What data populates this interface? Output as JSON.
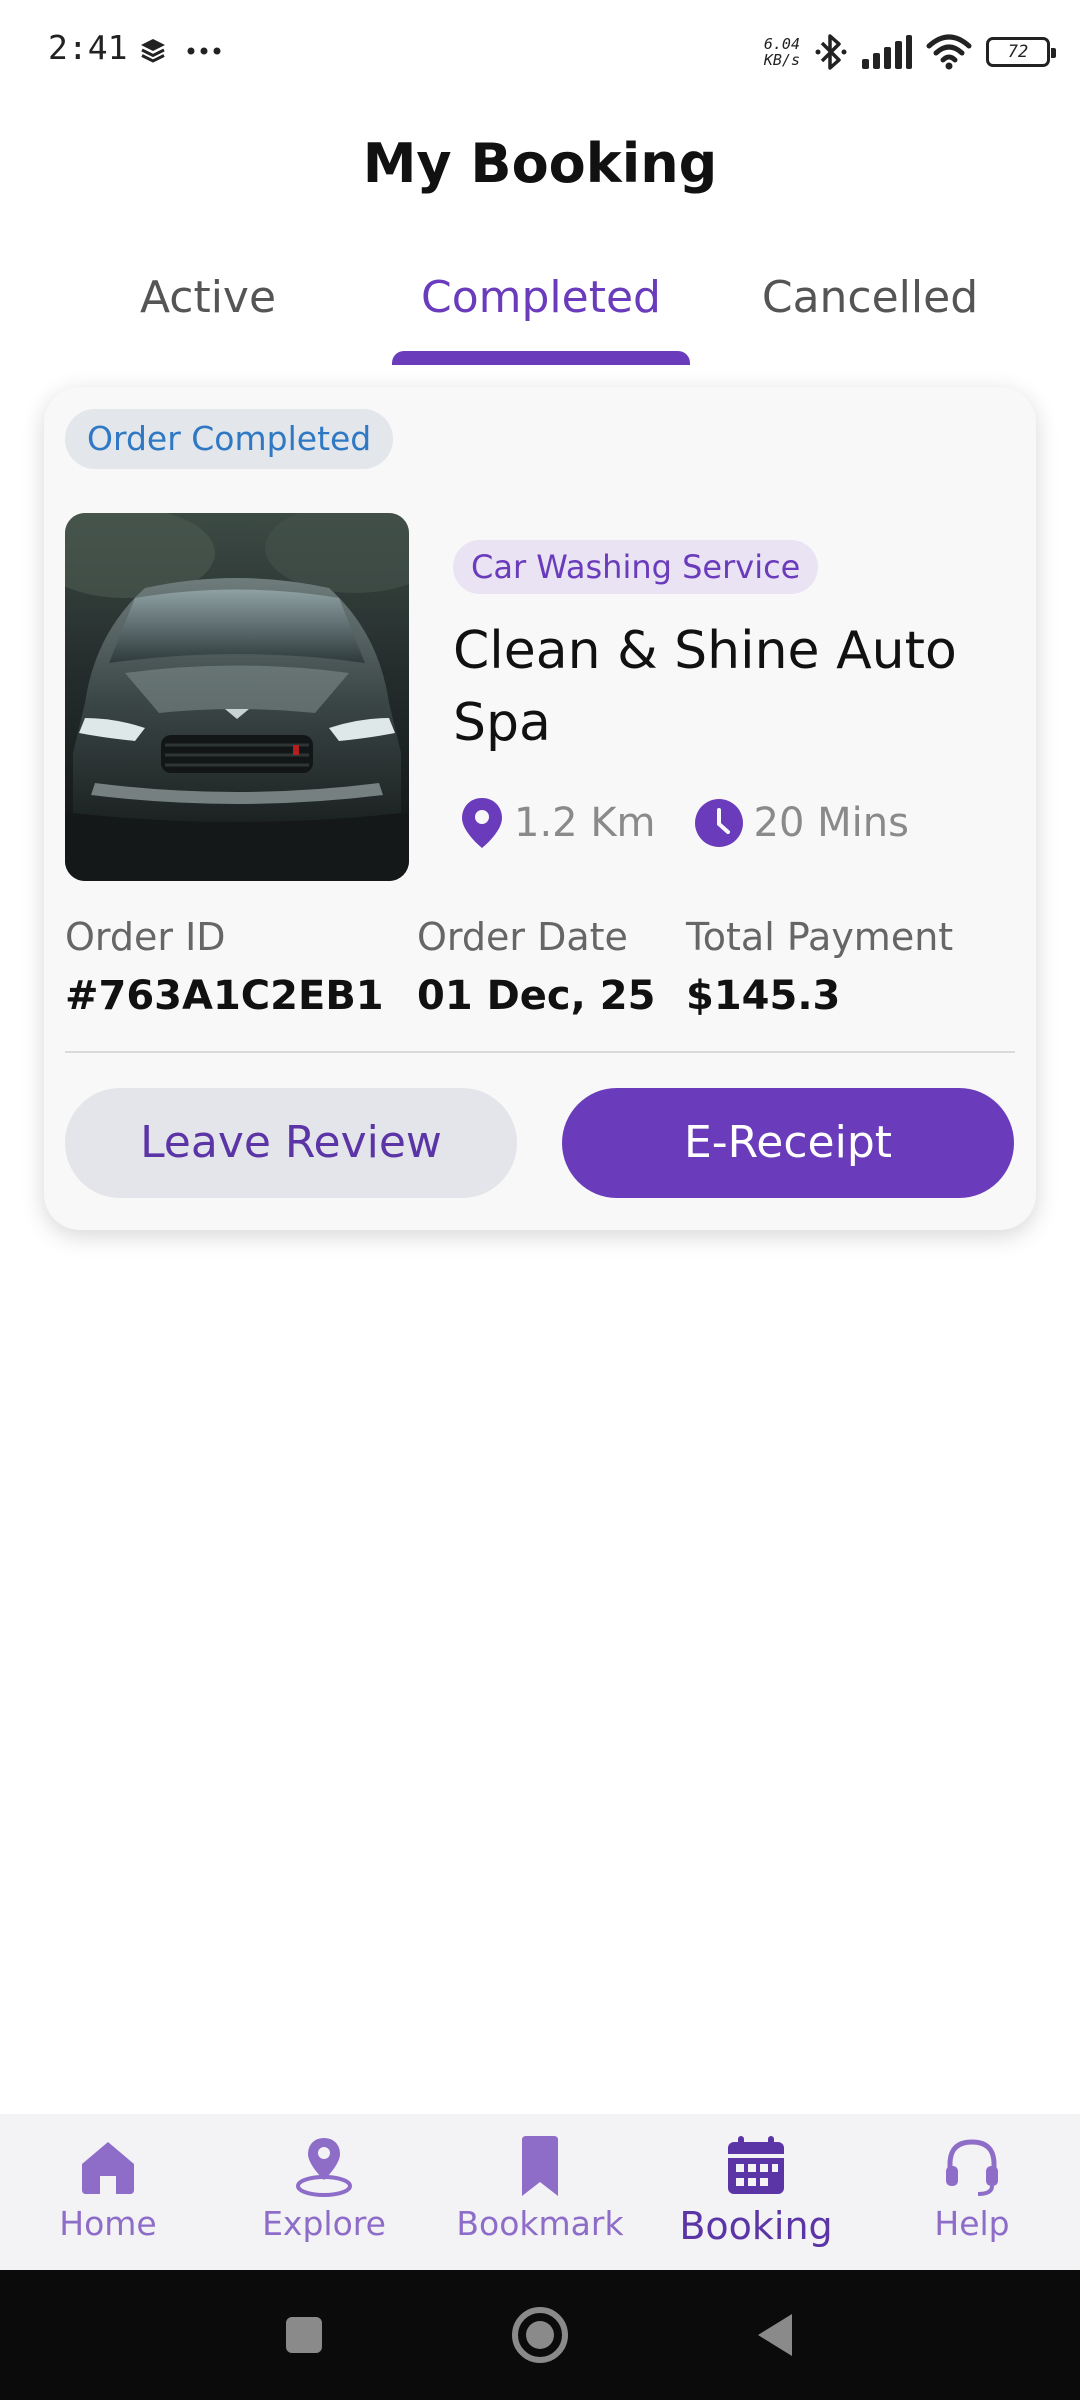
{
  "status_bar": {
    "time": "2:41",
    "net_speed_value": "6.04",
    "net_speed_unit": "KB/s",
    "battery": "72",
    "icons": [
      "layers-icon",
      "more-dots-icon",
      "bluetooth-icon",
      "signal-icon",
      "wifi-icon",
      "battery-icon"
    ]
  },
  "header": {
    "title": "My Booking"
  },
  "tabs": [
    {
      "label": "Active",
      "selected": false
    },
    {
      "label": "Completed",
      "selected": true
    },
    {
      "label": "Cancelled",
      "selected": false
    }
  ],
  "booking": {
    "status_badge": "Order Completed",
    "category": "Car Washing Service",
    "name": "Clean & Shine Auto Spa",
    "distance": "1.2 Km",
    "duration": "20 Mins",
    "order_id_label": "Order ID",
    "order_id": "#763A1C2EB1",
    "order_date_label": "Order Date",
    "order_date": "01 Dec, 25",
    "total_label": "Total Payment",
    "total": "$145.3",
    "review_button": "Leave Review",
    "receipt_button": "E-Receipt"
  },
  "bottom_nav": {
    "items": [
      {
        "label": "Home",
        "icon": "home-icon"
      },
      {
        "label": "Explore",
        "icon": "location-pin-icon"
      },
      {
        "label": "Bookmark",
        "icon": "bookmark-icon"
      },
      {
        "label": "Booking",
        "icon": "calendar-icon"
      },
      {
        "label": "Help",
        "icon": "headset-icon"
      }
    ],
    "active": "Booking"
  },
  "colors": {
    "accent": "#6a3cbc",
    "badge_text": "#2f78c4",
    "muted": "#8a8a8a"
  }
}
